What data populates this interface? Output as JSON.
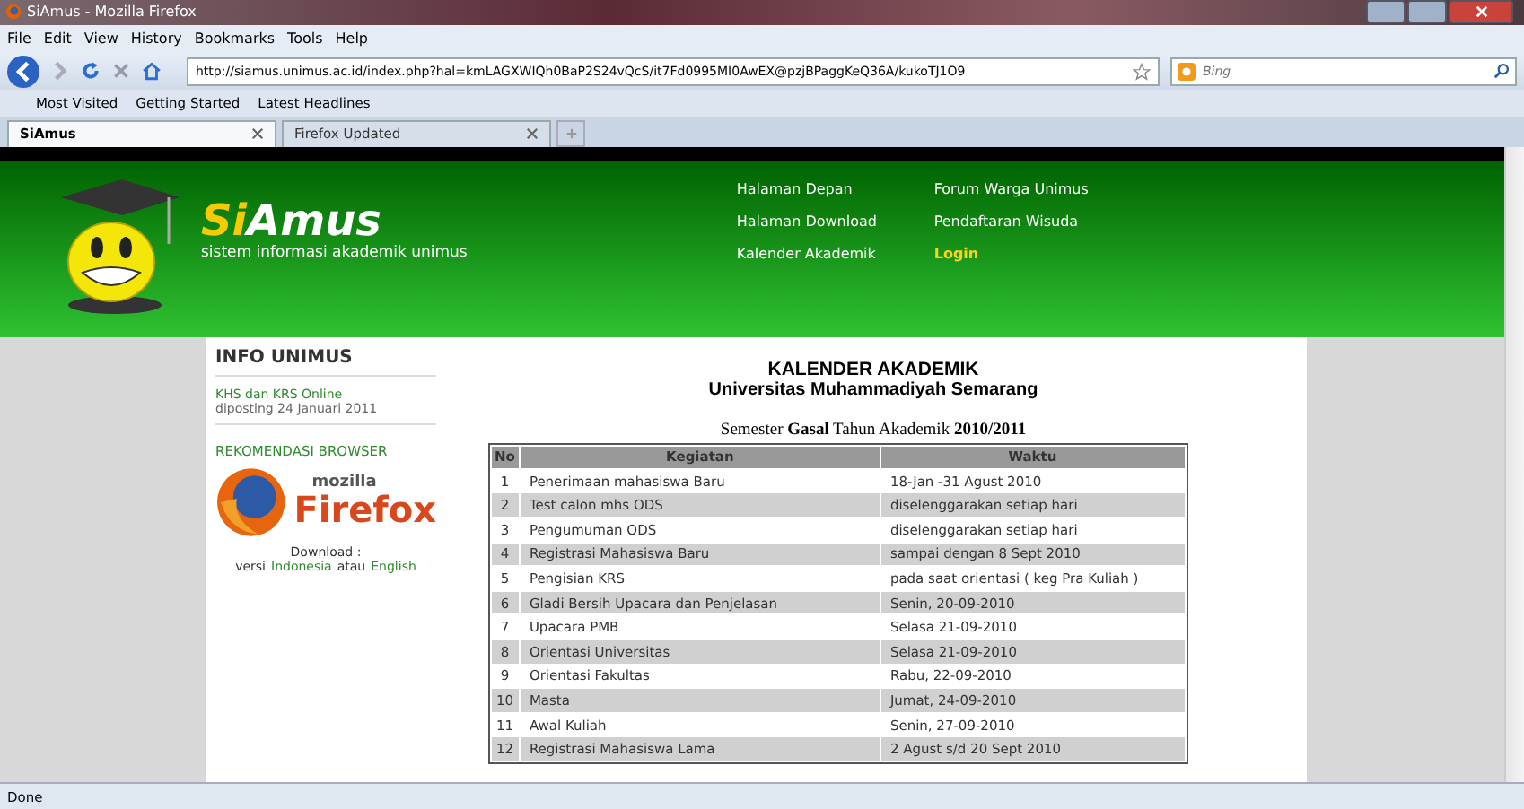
{
  "window": {
    "title": "SiAmus - Mozilla Firefox"
  },
  "menu": [
    "File",
    "Edit",
    "View",
    "History",
    "Bookmarks",
    "Tools",
    "Help"
  ],
  "address": {
    "value": "http://siamus.unimus.ac.id/index.php?hal=kmLAGXWIQh0BaP2S24vQcS/it7Fd0995MI0AwEX@pzjBPaggKeQ36A/kukoTJ1O9"
  },
  "search": {
    "placeholder": "Bing"
  },
  "bookmarks": [
    "Most Visited",
    "Getting Started",
    "Latest Headlines"
  ],
  "tabs": [
    {
      "label": "SiAmus",
      "selected": true
    },
    {
      "label": "Firefox Updated",
      "selected": false
    }
  ],
  "site": {
    "logo_part1": "Si",
    "logo_part2": "Amus",
    "tagline": "sistem informasi akademik unimus",
    "nav": [
      {
        "label": "Halaman Depan",
        "highlighted": false
      },
      {
        "label": "Forum Warga Unimus",
        "highlighted": false
      },
      {
        "label": "Halaman Download",
        "highlighted": false
      },
      {
        "label": "Pendaftaran Wisuda",
        "highlighted": false
      },
      {
        "label": "Kalender Akademik",
        "highlighted": false
      },
      {
        "label": "Login",
        "highlighted": true
      }
    ]
  },
  "sidebar": {
    "heading": "INFO UNIMUS",
    "news_title": "KHS dan KRS Online",
    "news_date": "diposting 24 Januari 2011",
    "browser_heading": "REKOMENDASI BROWSER",
    "brand_small": "mozilla",
    "brand_big": "Firefox",
    "download_label": "Download :",
    "download_prefix": "versi",
    "download_link1": "Indonesia",
    "download_middle": "atau",
    "download_link2": "English"
  },
  "calendar": {
    "title": "KALENDER AKADEMIK",
    "subtitle": "Universitas Muhammadiyah Semarang",
    "semester": "Semester **Gasal** Tahun Akademik **2010/2011**",
    "columns": [
      "No",
      "Kegiatan",
      "Waktu"
    ],
    "rows": [
      [
        "1",
        "Penerimaan mahasiswa Baru",
        "18-Jan -31 Agust 2010"
      ],
      [
        "2",
        "Test calon mhs ODS",
        "diselenggarakan setiap hari"
      ],
      [
        "3",
        "Pengumuman ODS",
        "diselenggarakan setiap hari"
      ],
      [
        "4",
        "Registrasi Mahasiswa Baru",
        "sampai dengan 8 Sept 2010"
      ],
      [
        "5",
        "Pengisian KRS",
        "pada saat orientasi ( keg Pra Kuliah )"
      ],
      [
        "6",
        "Gladi Bersih Upacara dan Penjelasan",
        "Senin, 20-09-2010"
      ],
      [
        "7",
        "Upacara PMB",
        "Selasa 21-09-2010"
      ],
      [
        "8",
        "Orientasi Universitas",
        "Selasa 21-09-2010"
      ],
      [
        "9",
        "Orientasi Fakultas",
        "Rabu, 22-09-2010"
      ],
      [
        "10",
        "Masta",
        "Jumat, 24-09-2010"
      ],
      [
        "11",
        "Awal Kuliah",
        "Senin, 27-09-2010"
      ],
      [
        "12",
        "Registrasi Mahasiswa Lama",
        "2 Agust s/d 20 Sept 2010"
      ]
    ]
  },
  "status_bar": "Done"
}
